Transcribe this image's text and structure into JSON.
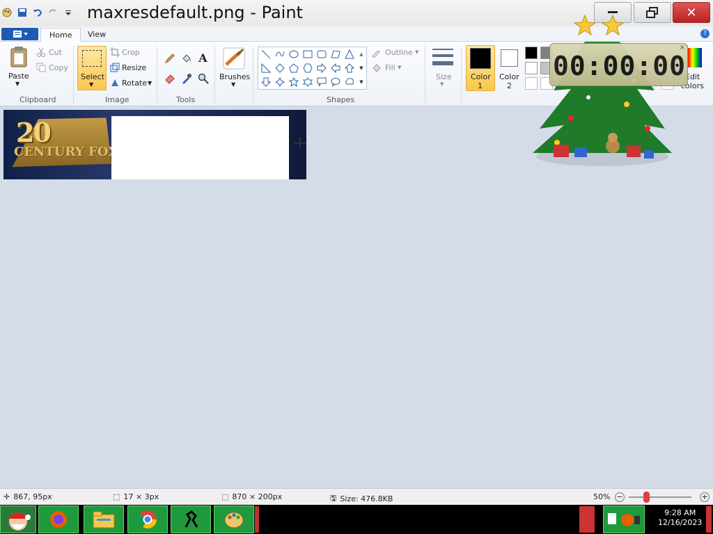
{
  "window": {
    "title": "maxresdefault.png - Paint"
  },
  "tabs": {
    "file_icon": "paint-menu-icon",
    "home": "Home",
    "view": "View"
  },
  "clipboard": {
    "paste": "Paste",
    "cut": "Cut",
    "copy": "Copy",
    "group": "Clipboard"
  },
  "image": {
    "select": "Select",
    "crop": "Crop",
    "resize": "Resize",
    "rotate": "Rotate",
    "group": "Image"
  },
  "tools": {
    "group": "Tools",
    "text_glyph": "A"
  },
  "brushes": {
    "label": "Brushes"
  },
  "shapes": {
    "group": "Shapes",
    "outline": "Outline",
    "fill": "Fill"
  },
  "size": {
    "label": "Size"
  },
  "colors": {
    "color1_label": "Color",
    "color1_num": "1",
    "color2_label": "Color",
    "color2_num": "2",
    "edit_colors_1": "Edit",
    "edit_colors_2": "colors",
    "color1": "#000000",
    "color2": "#ffffff"
  },
  "canvas": {
    "logo_top": "20",
    "logo_bottom": "CENTURY FOX"
  },
  "widget": {
    "clock": "00:00:00"
  },
  "status": {
    "cursor_pos": "867, 95px",
    "selection_size": "17 × 3px",
    "image_size": "870 × 200px",
    "file_size": "Size: 476.8KB",
    "zoom": "50%"
  },
  "tray": {
    "time": "9:28 AM",
    "date": "12/16/2023"
  }
}
